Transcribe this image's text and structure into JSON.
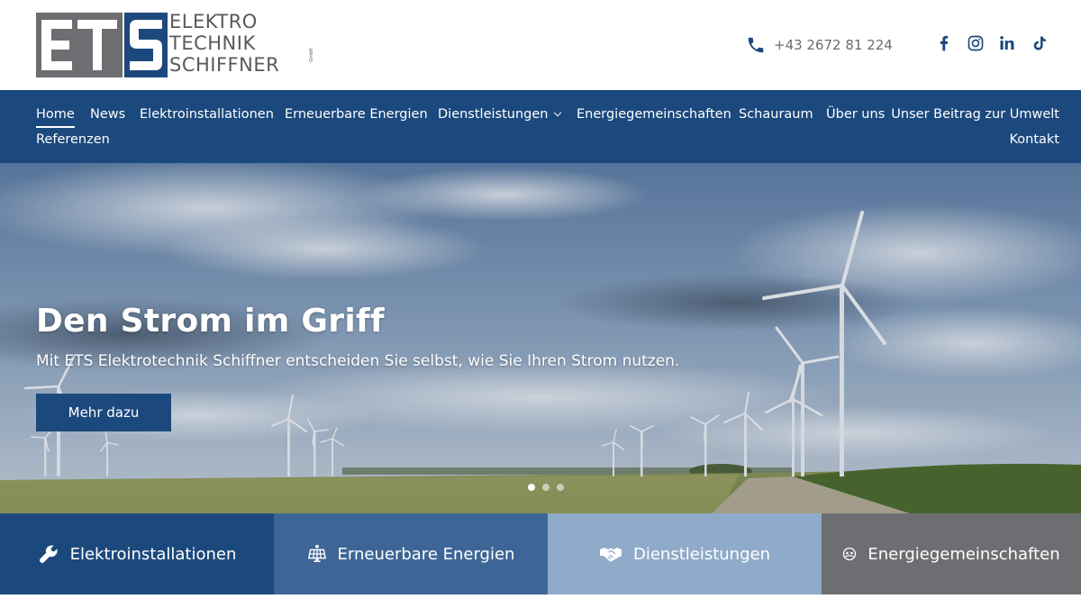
{
  "brand": {
    "logo_letters": "ETS",
    "lines": [
      "ELEKTRO",
      "TECHNIK",
      "SCHIFFNER"
    ],
    "suffix": "GmbH",
    "colors": {
      "grey": "#6d6e71",
      "blue": "#1c497d"
    }
  },
  "contact": {
    "phone": "+43 2672 81 224",
    "icon": "phone-icon"
  },
  "social": [
    {
      "name": "facebook-icon"
    },
    {
      "name": "instagram-icon"
    },
    {
      "name": "linkedin-icon"
    },
    {
      "name": "tiktok-icon"
    }
  ],
  "nav": {
    "items": [
      {
        "label": "Home",
        "active": true
      },
      {
        "label": "News"
      },
      {
        "label": "Elektroinstallationen"
      },
      {
        "label": "Erneuerbare Energien"
      },
      {
        "label": "Dienstleistungen",
        "has_dropdown": true
      },
      {
        "label": "Energiegemeinschaften"
      },
      {
        "label": "Schauraum"
      },
      {
        "label": "Über uns"
      },
      {
        "label": "Unser Beitrag zur Umwelt"
      },
      {
        "label": "Referenzen"
      },
      {
        "label": "Kontakt"
      }
    ],
    "color": "#1c497d"
  },
  "hero": {
    "title": "Den Strom im Griff",
    "subtitle": "Mit ETS Elektrotechnik Schiffner entscheiden Sie selbst, wie Sie Ihren Strom nutzen.",
    "button_label": "Mehr dazu",
    "slides": 3,
    "active_slide": 1
  },
  "tiles": [
    {
      "label": "Elektroinstallationen",
      "icon": "wrench-icon",
      "color": "#1c497d"
    },
    {
      "label": "Erneuerbare Energien",
      "icon": "solar-panel-icon",
      "color": "#3d6696"
    },
    {
      "label": "Dienstleistungen",
      "icon": "handshake-icon",
      "color": "#8fabc9"
    },
    {
      "label": "Energiegemeinschaften",
      "icon": "community-icon",
      "color": "#6d6e71"
    }
  ]
}
